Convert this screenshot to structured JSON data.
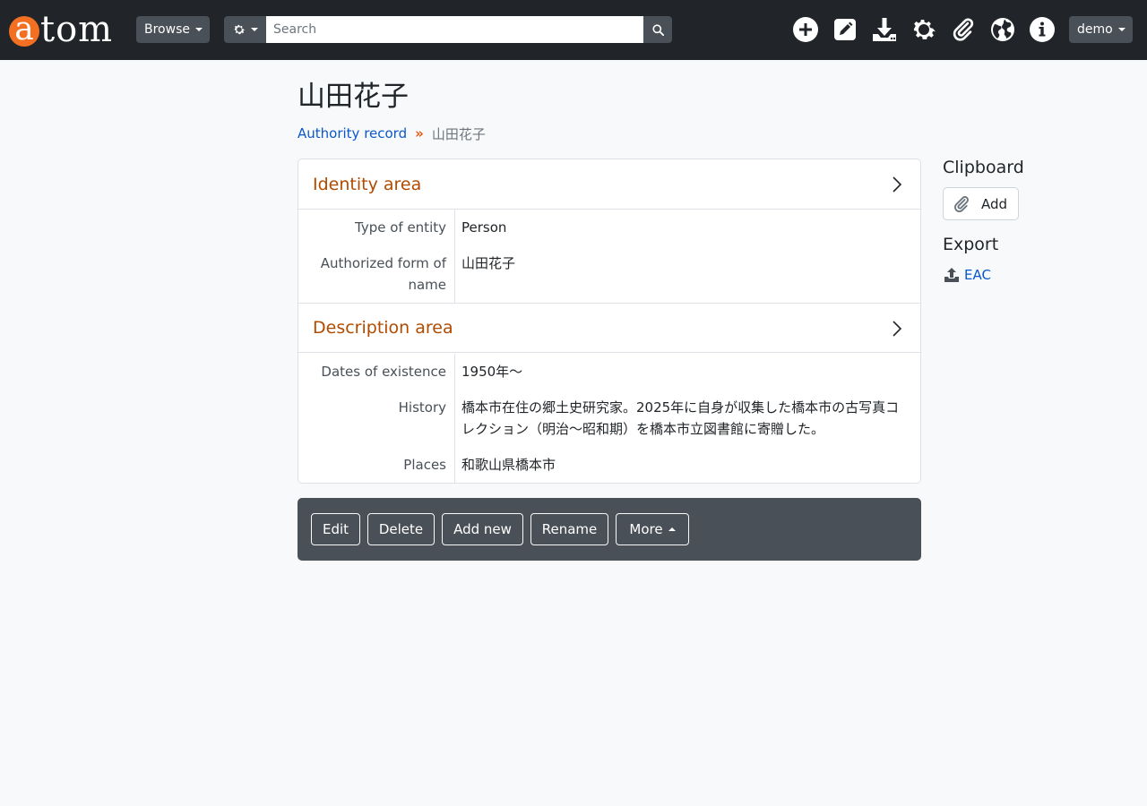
{
  "header": {
    "logo_a": "a",
    "logo_rest": "tom",
    "browse_label": "Browse",
    "search_placeholder": "Search",
    "user_label": "demo"
  },
  "page": {
    "title": "山田花子",
    "breadcrumb": {
      "parent": "Authority record",
      "separator": "»",
      "current": "山田花子"
    }
  },
  "identity": {
    "heading": "Identity area",
    "fields": [
      {
        "label": "Type of entity",
        "value": "Person"
      },
      {
        "label": "Authorized form of name",
        "value": "山田花子"
      }
    ]
  },
  "description": {
    "heading": "Description area",
    "fields": [
      {
        "label": "Dates of existence",
        "value": "1950年〜"
      },
      {
        "label": "History",
        "value": "橋本市在住の郷土史研究家。2025年に自身が収集した橋本市の古写真コレクション（明治〜昭和期）を橋本市立図書館に寄贈した。"
      },
      {
        "label": "Places",
        "value": "和歌山県橋本市"
      }
    ]
  },
  "actions": {
    "edit": "Edit",
    "delete": "Delete",
    "add_new": "Add new",
    "rename": "Rename",
    "more": "More"
  },
  "sidebar": {
    "clipboard_heading": "Clipboard",
    "clipboard_add": "Add",
    "export_heading": "Export",
    "export_eac": "EAC"
  },
  "colors": {
    "topbar": "#212529",
    "accent_logo": "#f36f21",
    "section_heading": "#b04b00",
    "link": "#0a58ca",
    "action_bar": "#495057"
  }
}
